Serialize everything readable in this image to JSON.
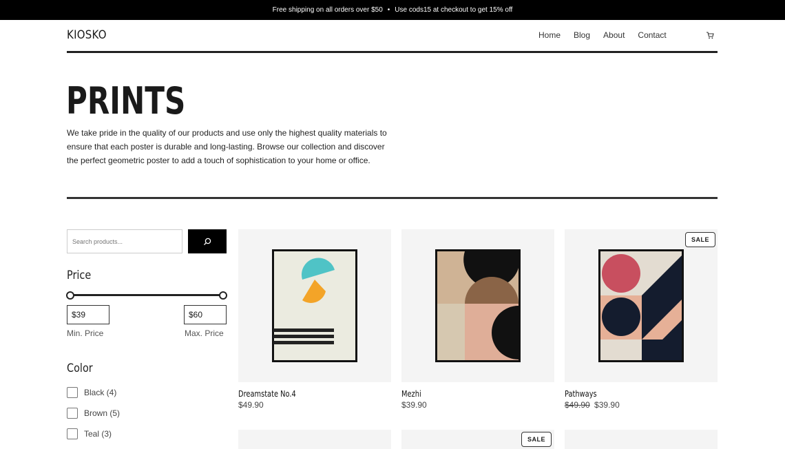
{
  "announcement": {
    "left": "Free shipping on all orders over $50",
    "separator": "•",
    "right": "Use cods15 at checkout to get 15% off"
  },
  "header": {
    "logo": "KIOSKO",
    "nav": [
      "Home",
      "Blog",
      "About",
      "Contact"
    ],
    "cart_icon": "cart-icon"
  },
  "hero": {
    "title": "PRINTS",
    "description": "We take pride in the quality of our products and use only the highest quality materials to ensure that each poster is durable and long-lasting. Browse our collection and discover the perfect geometric poster to add a touch of sophistication to your home or office."
  },
  "sidebar": {
    "search_placeholder": "Search products...",
    "search_icon": "search-icon",
    "price": {
      "title": "Price",
      "min_value": "$39",
      "max_value": "$60",
      "min_label": "Min. Price",
      "max_label": "Max. Price"
    },
    "color": {
      "title": "Color",
      "options": [
        "Black (4)",
        "Brown (5)",
        "Teal (3)"
      ]
    }
  },
  "products": [
    {
      "name": "Dreamstate No.4",
      "price": "$49.90",
      "old_price": "",
      "badge": ""
    },
    {
      "name": "Mezhi",
      "price": "$39.90",
      "old_price": "",
      "badge": ""
    },
    {
      "name": "Pathways",
      "price": "$39.90",
      "old_price": "$49.90",
      "badge": "SALE"
    }
  ],
  "second_row_badge": "SALE",
  "colors": {
    "accent": "#000000",
    "background": "#ffffff",
    "card_bg": "#f4f4f4"
  }
}
